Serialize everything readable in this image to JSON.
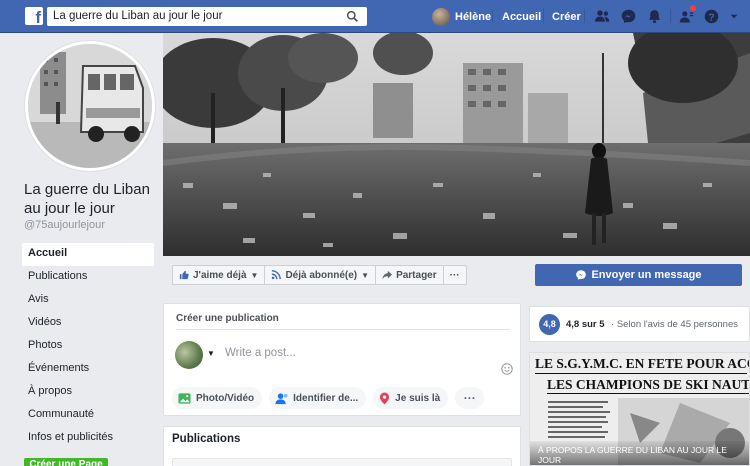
{
  "topbar": {
    "logo": "f",
    "search_value": "La guerre du Liban au jour le jour",
    "user_name": "Hélène",
    "home_label": "Accueil",
    "create_label": "Créer",
    "icons": [
      "friends-icon",
      "messenger-icon",
      "bell-icon",
      "help-icon"
    ]
  },
  "page": {
    "title": "La guerre du Liban au jour le jour",
    "handle": "@75aujourlejour"
  },
  "left_nav": {
    "items": [
      {
        "label": "Accueil",
        "active": true
      },
      {
        "label": "Publications"
      },
      {
        "label": "Avis"
      },
      {
        "label": "Vidéos"
      },
      {
        "label": "Photos"
      },
      {
        "label": "Événements"
      },
      {
        "label": "À propos"
      },
      {
        "label": "Communauté"
      },
      {
        "label": "Infos et publicités"
      }
    ],
    "cta_label": "Créer une Page"
  },
  "actions": {
    "like": "J'aime déjà",
    "follow": "Déjà abonné(e)",
    "share": "Partager",
    "more": "···",
    "message": "Envoyer un message"
  },
  "create_post": {
    "title": "Créer une publication",
    "placeholder": "Write a post...",
    "chips": [
      "Photo/Vidéo",
      "Identifier de...",
      "Je suis là"
    ],
    "more": "···"
  },
  "publications": {
    "title": "Publications"
  },
  "rating": {
    "score": "4,8",
    "text": "4,8 sur 5",
    "sub": "Selon l'avis de 45 personnes"
  },
  "news": {
    "headline1": "LE S.G.Y.M.C. EN FETE POUR ACCUEILLIR",
    "headline2": "LES CHAMPIONS DE SKI NAUTIQUE",
    "caption": "À PROPOS LA GUERRE DU LIBAN AU JOUR LE JOUR"
  },
  "colors": {
    "brand": "#4267b2",
    "background": "#e9ebee",
    "green": "#42b72a"
  }
}
